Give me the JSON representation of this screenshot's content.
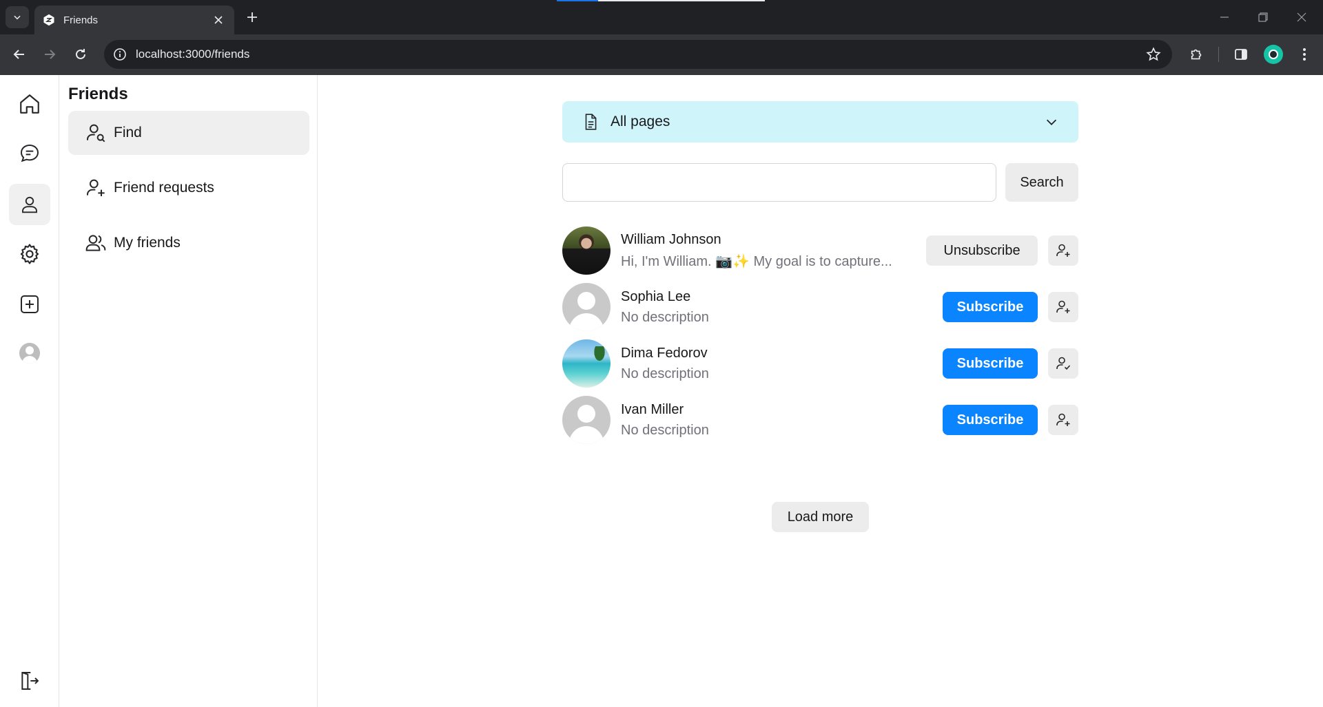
{
  "browser": {
    "tab_title": "Friends",
    "url": "localhost:3000/friends"
  },
  "rail": {
    "items": [
      {
        "icon": "home-icon"
      },
      {
        "icon": "chat-icon"
      },
      {
        "icon": "user-icon"
      },
      {
        "icon": "gear-icon"
      },
      {
        "icon": "plus-square-icon"
      },
      {
        "icon": "avatar-icon"
      }
    ],
    "logout_icon": "logout-icon"
  },
  "subnav": {
    "title": "Friends",
    "items": [
      {
        "label": "Find",
        "icon": "user-search-icon",
        "active": true
      },
      {
        "label": "Friend requests",
        "icon": "user-plus-icon",
        "active": false
      },
      {
        "label": "My friends",
        "icon": "users-icon",
        "active": false
      }
    ]
  },
  "main": {
    "pages_select": {
      "label": "All pages"
    },
    "search": {
      "value": "",
      "placeholder": "",
      "button_label": "Search"
    },
    "users": [
      {
        "name": "William Johnson",
        "description": "Hi, I'm William. 📷✨ My goal is to capture...",
        "action": "Unsubscribe",
        "avatar": "photo"
      },
      {
        "name": "Sophia Lee",
        "description": "No description",
        "action": "Subscribe",
        "avatar": "default"
      },
      {
        "name": "Dima Fedorov",
        "description": "No description",
        "action": "Subscribe",
        "avatar": "beach"
      },
      {
        "name": "Ivan Miller",
        "description": "No description",
        "action": "Subscribe",
        "avatar": "default"
      }
    ],
    "load_more_label": "Load more"
  },
  "colors": {
    "accent": "#0a84ff",
    "select_bg": "#cff5fb",
    "chrome_dark": "#202124"
  }
}
